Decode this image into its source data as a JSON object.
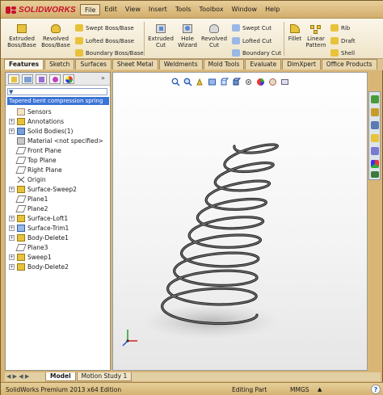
{
  "app": {
    "brand": "SOLIDWORKS"
  },
  "menu": {
    "items": [
      "File",
      "Edit",
      "View",
      "Insert",
      "Tools",
      "Toolbox",
      "Window",
      "Help"
    ]
  },
  "ribbon": {
    "extruded_boss": "Extruded Boss/Base",
    "revolved_boss": "Revolved Boss/Base",
    "swept_boss": "Swept Boss/Base",
    "lofted_boss": "Lofted Boss/Base",
    "boundary_boss": "Boundary Boss/Base",
    "extruded_cut": "Extruded Cut",
    "hole_wizard": "Hole Wizard",
    "revolved_cut": "Revolved Cut",
    "swept_cut": "Swept Cut",
    "lofted_cut": "Lofted Cut",
    "boundary_cut": "Boundary Cut",
    "fillet": "Fillet",
    "linear_pattern": "Linear Pattern",
    "rib": "Rib",
    "draft": "Draft",
    "shell": "Shell"
  },
  "command_tabs": [
    "Features",
    "Sketch",
    "Surfaces",
    "Sheet Metal",
    "Weldments",
    "Mold Tools",
    "Evaluate",
    "DimXpert",
    "Office Products"
  ],
  "tree": {
    "root": "Tapered bent compression spring",
    "items": [
      {
        "label": "Sensors",
        "expandable": false
      },
      {
        "label": "Annotations",
        "expandable": true
      },
      {
        "label": "Solid Bodies(1)",
        "expandable": true
      },
      {
        "label": "Material <not specified>",
        "expandable": false
      },
      {
        "label": "Front Plane",
        "expandable": false
      },
      {
        "label": "Top Plane",
        "expandable": false
      },
      {
        "label": "Right Plane",
        "expandable": false
      },
      {
        "label": "Origin",
        "expandable": false
      },
      {
        "label": "Surface-Sweep2",
        "expandable": true
      },
      {
        "label": "Plane1",
        "expandable": false
      },
      {
        "label": "Plane2",
        "expandable": false
      },
      {
        "label": "Surface-Loft1",
        "expandable": true
      },
      {
        "label": "Surface-Trim1",
        "expandable": true
      },
      {
        "label": "Body-Delete1",
        "expandable": true
      },
      {
        "label": "Plane3",
        "expandable": false
      },
      {
        "label": "Sweep1",
        "expandable": true
      },
      {
        "label": "Body-Delete2",
        "expandable": true
      }
    ]
  },
  "bottom_tabs": [
    "Model",
    "Motion Study 1"
  ],
  "status": {
    "edition": "SolidWorks Premium 2013 x64 Edition",
    "mode": "Editing Part",
    "units": "MMGS",
    "help": "?"
  },
  "colors": {
    "brand_red": "#c8102e",
    "selection_blue": "#3b74d6",
    "frame_tan": "#d9b676"
  }
}
